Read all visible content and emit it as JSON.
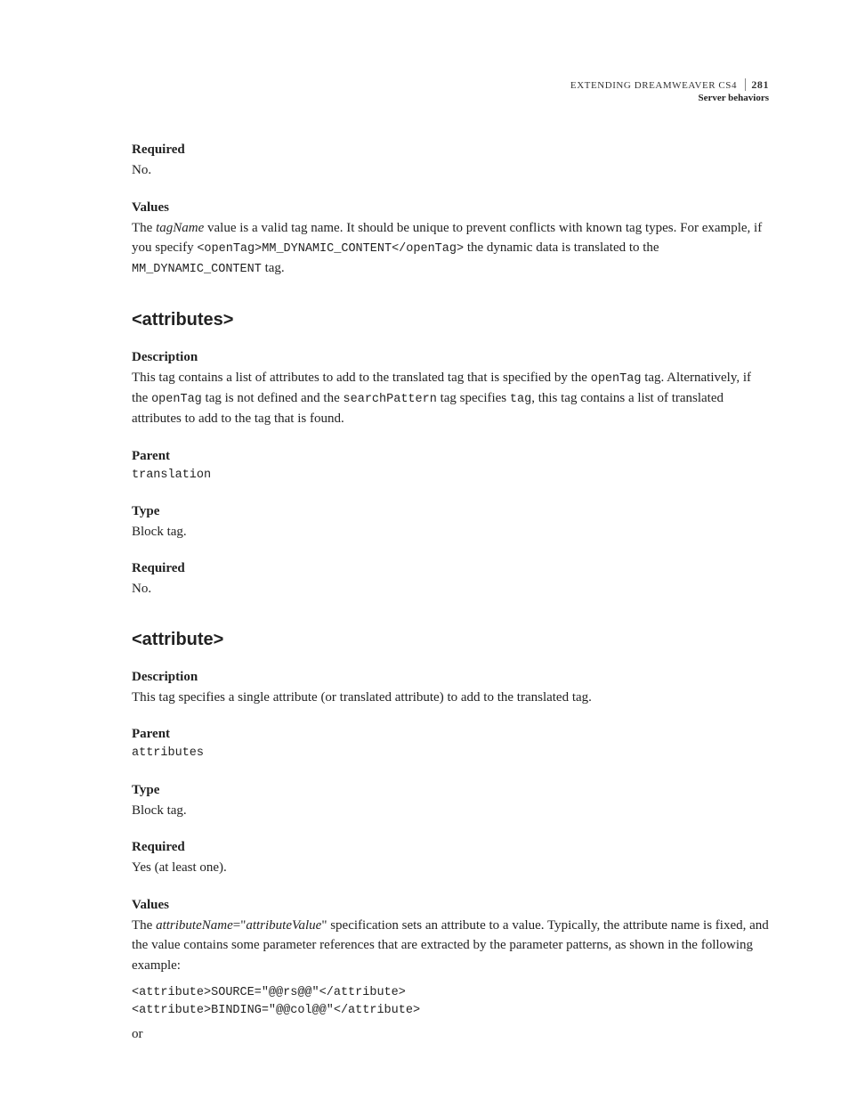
{
  "header": {
    "title_line": "EXTENDING DREAMWEAVER CS4",
    "page_number": "281",
    "section_line": "Server behaviors"
  },
  "top": {
    "required_label": "Required",
    "required_value": "No.",
    "values_label": "Values",
    "values_p1_a": "The ",
    "values_p1_term": "tagName",
    "values_p1_b": " value is a valid tag name. It should be unique to prevent conflicts with known tag types. For example, if you specify ",
    "values_p1_code": "<openTag>MM_DYNAMIC_CONTENT</openTag>",
    "values_p1_c": " the dynamic data is translated to the ",
    "values_p1_code2": "MM_DYNAMIC_CONTENT",
    "values_p1_d": " tag."
  },
  "attributes": {
    "heading": "<attributes>",
    "description_label": "Description",
    "description_a": "This tag contains a list of attributes to add to the translated tag that is specified by the ",
    "description_code1": "openTag",
    "description_b": " tag. Alternatively, if the ",
    "description_code2": "openTag",
    "description_c": " tag is not defined and the ",
    "description_code3": "searchPattern",
    "description_d": " tag specifies ",
    "description_code4": "tag",
    "description_e": ", this tag contains a list of translated attributes to add to the tag that is found.",
    "parent_label": "Parent",
    "parent_value": "translation",
    "type_label": "Type",
    "type_value": "Block tag.",
    "required_label": "Required",
    "required_value": "No."
  },
  "attribute": {
    "heading": "<attribute>",
    "description_label": "Description",
    "description_text": "This tag specifies a single attribute (or translated attribute) to add to the translated tag.",
    "parent_label": "Parent",
    "parent_value": "attributes",
    "type_label": "Type",
    "type_value": "Block tag.",
    "required_label": "Required",
    "required_value": "Yes (at least one).",
    "values_label": "Values",
    "values_a": "The ",
    "values_code_name": "attributeName",
    "values_eq": "=\"",
    "values_code_val": "attributeValue",
    "values_b": "\" specification sets an attribute to a value. Typically, the attribute name is fixed, and the value contains some parameter references that are extracted by the parameter patterns, as shown in the following example:",
    "code_block": "<attribute>SOURCE=\"@@rs@@\"</attribute>\n<attribute>BINDING=\"@@col@@\"</attribute>",
    "or_text": "or"
  }
}
